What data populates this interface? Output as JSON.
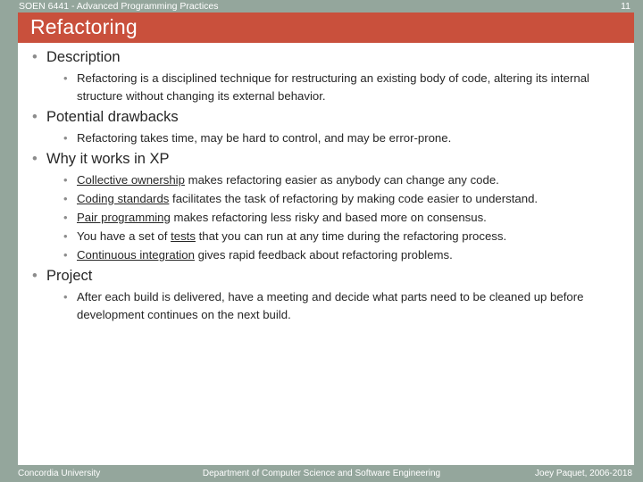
{
  "colors": {
    "accent_bar": "#94a69c",
    "title_bar": "#c9503c",
    "body_text": "#262626",
    "bullet": "#8c8c8c",
    "header_text": "#ffffff"
  },
  "header": {
    "course": "SOEN 6441 - Advanced Programming Practices",
    "page_number": "11"
  },
  "title": {
    "text": "Refactoring"
  },
  "bullet_glyph": "•",
  "content": {
    "sections": [
      {
        "heading": "Description",
        "items": [
          {
            "parts": [
              {
                "text": "Refactoring is a disciplined technique for restructuring an existing body of code, altering its internal structure without changing its external behavior.",
                "underline": false
              }
            ]
          }
        ]
      },
      {
        "heading": "Potential drawbacks",
        "items": [
          {
            "parts": [
              {
                "text": "Refactoring takes time, may be hard to control, and may be error-prone.",
                "underline": false
              }
            ]
          }
        ]
      },
      {
        "heading": "Why it works in XP",
        "items": [
          {
            "parts": [
              {
                "text": "Collective ownership",
                "underline": true
              },
              {
                "text": " makes refactoring easier as anybody can change any code.",
                "underline": false
              }
            ]
          },
          {
            "parts": [
              {
                "text": "Coding standards",
                "underline": true
              },
              {
                "text": " facilitates the task of refactoring by making code easier to understand.",
                "underline": false
              }
            ]
          },
          {
            "parts": [
              {
                "text": "Pair programming",
                "underline": true
              },
              {
                "text": " makes refactoring less risky and based more on consensus.",
                "underline": false
              }
            ]
          },
          {
            "parts": [
              {
                "text": "You have a set of ",
                "underline": false
              },
              {
                "text": "tests",
                "underline": true
              },
              {
                "text": " that you can run at any time during the refactoring process.",
                "underline": false
              }
            ]
          },
          {
            "parts": [
              {
                "text": "Continuous integration",
                "underline": true
              },
              {
                "text": " gives rapid feedback about refactoring problems.",
                "underline": false
              }
            ]
          }
        ]
      },
      {
        "heading": "Project",
        "items": [
          {
            "parts": [
              {
                "text": "After each build is delivered, have a meeting and decide what parts need to be cleaned up before development continues on the next build.",
                "underline": false
              }
            ]
          }
        ]
      }
    ]
  },
  "footer": {
    "left": "Concordia University",
    "center": "Department of Computer Science and Software Engineering",
    "right": "Joey Paquet, 2006-2018"
  }
}
